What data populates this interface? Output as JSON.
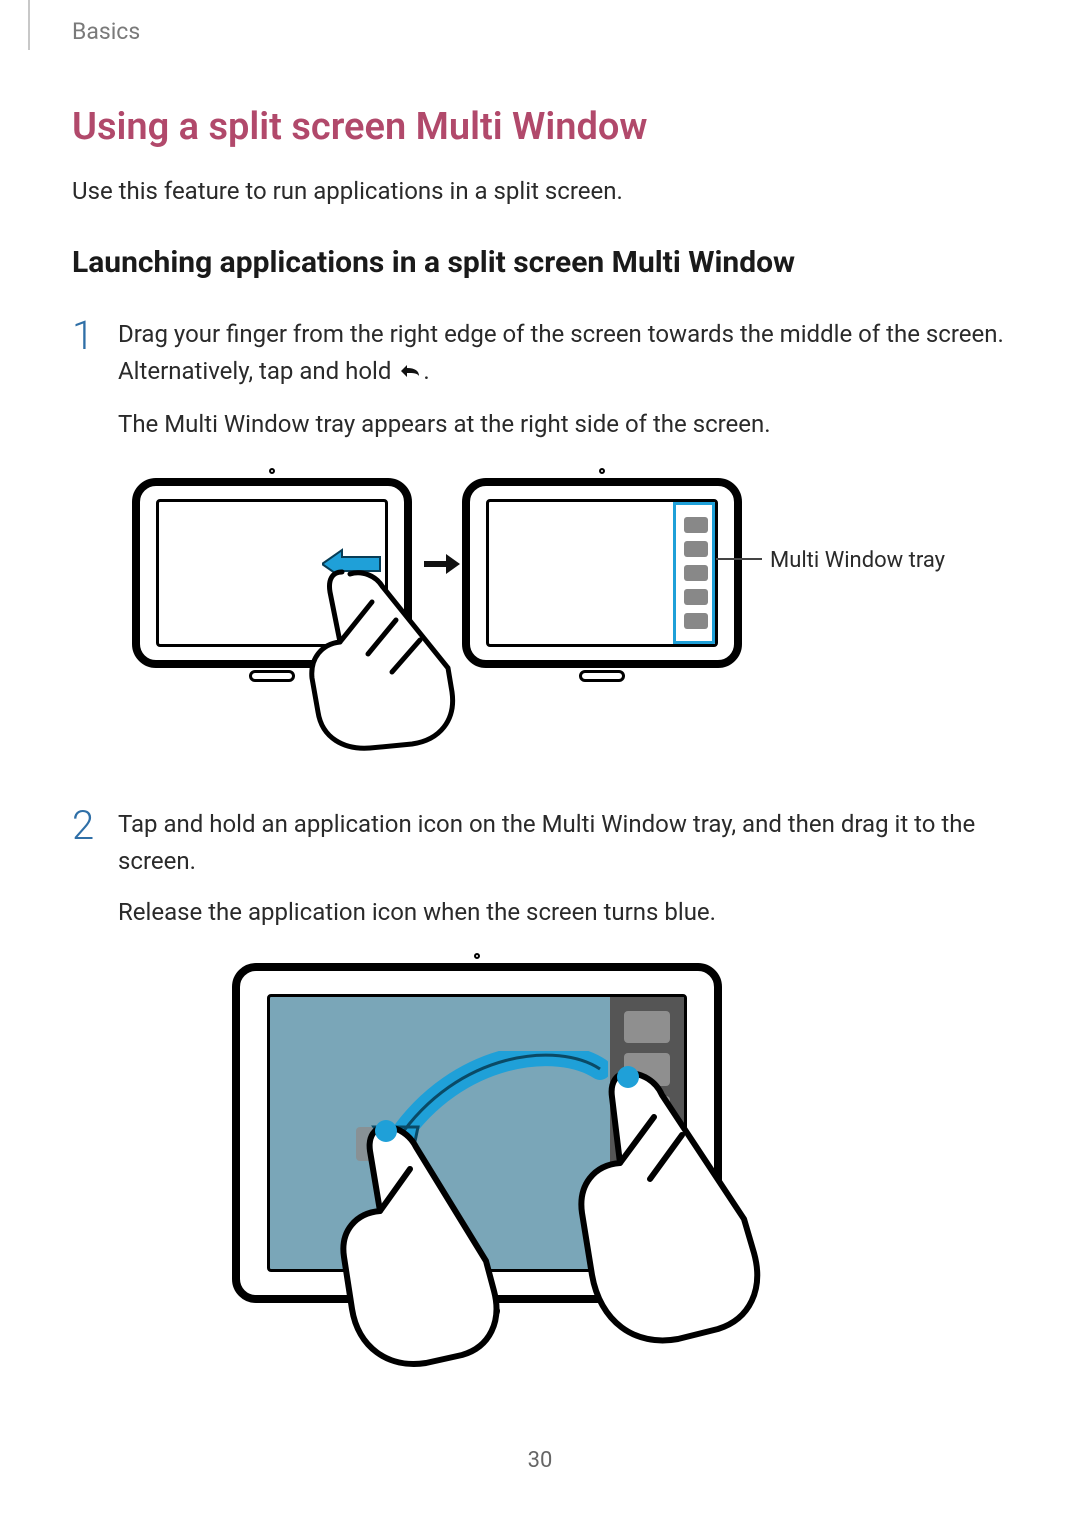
{
  "breadcrumb": "Basics",
  "heading": "Using a split screen Multi Window",
  "intro": "Use this feature to run applications in a split screen.",
  "subheading": "Launching applications in a split screen Multi Window",
  "steps": {
    "s1": {
      "num": "1",
      "p1a": "Drag your finger from the right edge of the screen towards the middle of the screen. Alternatively, tap and hold ",
      "p1b": ".",
      "p2": "The Multi Window tray appears at the right side of the screen."
    },
    "s2": {
      "num": "2",
      "p1": "Tap and hold an application icon on the Multi Window tray, and then drag it to the screen.",
      "p2": "Release the application icon when the screen turns blue."
    }
  },
  "callout": "Multi Window tray",
  "pageNumber": "30"
}
